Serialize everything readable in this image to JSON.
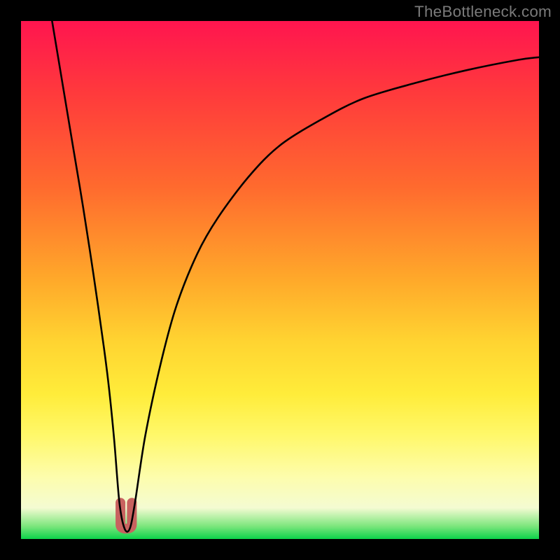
{
  "watermark": "TheBottleneck.com",
  "gradient": {
    "top_color": "#ff154f",
    "mid1_color": "#ff6a2e",
    "mid2_color": "#ffd431",
    "cream_color": "#fdfdac",
    "bottom_color": "#0cd24a"
  },
  "chart_data": {
    "type": "line",
    "title": "",
    "xlabel": "",
    "ylabel": "",
    "xlim": [
      0,
      100
    ],
    "ylim": [
      0,
      100
    ],
    "legend": false,
    "grid": false,
    "series": [
      {
        "name": "bottleneck-curve",
        "x": [
          6,
          8,
          10,
          12,
          14,
          16,
          17,
          18,
          19,
          20,
          21,
          22,
          24,
          27,
          30,
          34,
          38,
          44,
          50,
          58,
          66,
          76,
          86,
          96,
          100
        ],
        "values": [
          100,
          88,
          76,
          64,
          51,
          37,
          29,
          19,
          7,
          2,
          2,
          7,
          20,
          34,
          45,
          55,
          62,
          70,
          76,
          81,
          85,
          88,
          90.5,
          92.5,
          93
        ]
      }
    ],
    "annotations": [
      {
        "name": "min-marker",
        "shape": "u",
        "x_range": [
          19.2,
          21.4
        ],
        "y_range": [
          2,
          7
        ],
        "color": "#c8625f",
        "stroke_width_px": 14
      }
    ]
  }
}
